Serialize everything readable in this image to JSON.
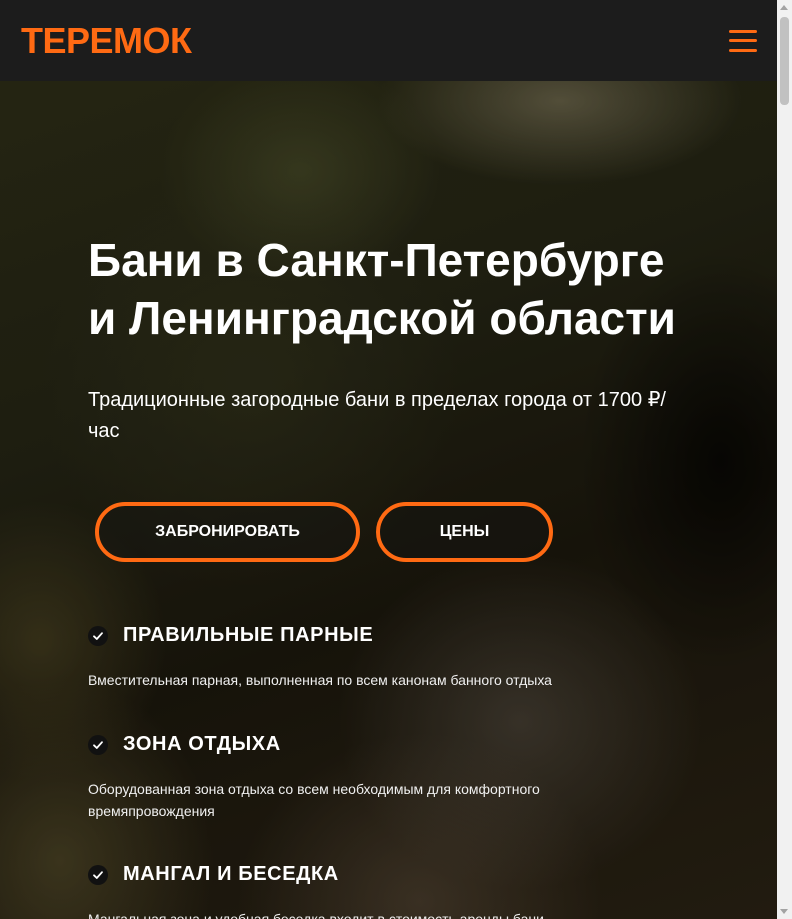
{
  "header": {
    "logo": "ТЕРЕМОК"
  },
  "hero": {
    "title_line1": "Бани в Санкт-Петербурге",
    "title_line2": "и Ленинградской области",
    "subtitle": "Традиционные загородные бани в пределах города от 1700 ₽/час",
    "book_button": "ЗАБРОНИРОВАТЬ",
    "prices_button": "ЦЕНЫ"
  },
  "features": [
    {
      "title": "ПРАВИЛЬНЫЕ ПАРНЫЕ",
      "text": "Вместительная парная, выполненная по всем канонам банного отдыха",
      "icon": "check-icon"
    },
    {
      "title": "ЗОНА ОТДЫХА",
      "text": "Оборудованная зона отдыха со всем необходимым для комфортного времяпровождения",
      "icon": "check-icon"
    },
    {
      "title": "МАНГАЛ И БЕСЕДКА",
      "text": "Мангальная зона и удобная беседка входит в стоимость аренды бани",
      "icon": "check-icon"
    }
  ],
  "colors": {
    "accent": "#ff6a13",
    "header_bg": "#1c1c1c"
  }
}
